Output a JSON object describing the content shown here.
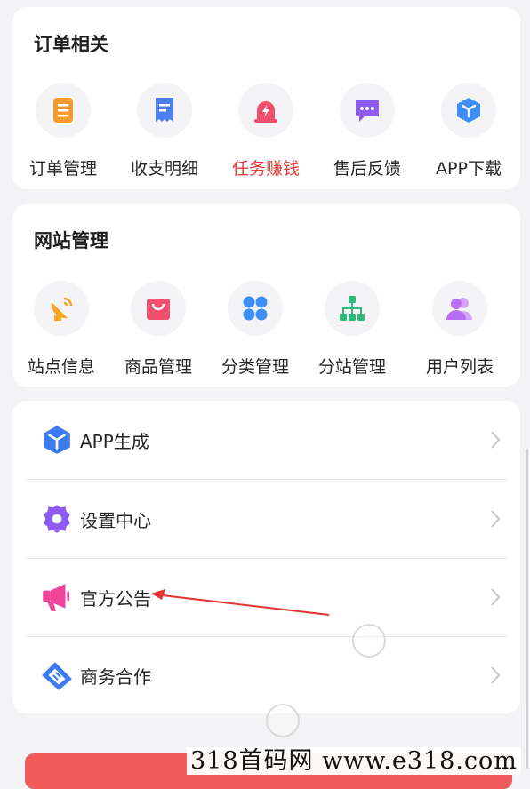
{
  "orders": {
    "title": "订单相关",
    "items": [
      {
        "label": "订单管理",
        "icon": "order-list-icon",
        "color": "#f79a2e"
      },
      {
        "label": "收支明细",
        "icon": "receipt-icon",
        "color": "#4f7ef0"
      },
      {
        "label": "任务赚钱",
        "icon": "alarm-bolt-icon",
        "color": "#f0506e",
        "highlight": true
      },
      {
        "label": "售后反馈",
        "icon": "chat-bubble-icon",
        "color": "#8e5cf0"
      },
      {
        "label": "APP下载",
        "icon": "cube-icon",
        "color": "#3d8ef7"
      }
    ]
  },
  "site": {
    "title": "网站管理",
    "items": [
      {
        "label": "站点信息",
        "icon": "satellite-dish-icon",
        "color": "#f5a623"
      },
      {
        "label": "商品管理",
        "icon": "shopping-bag-icon",
        "color": "#f0506e"
      },
      {
        "label": "分类管理",
        "icon": "category-grid-icon",
        "color": "#3d8ef7"
      },
      {
        "label": "分站管理",
        "icon": "org-tree-icon",
        "color": "#2fb87a"
      },
      {
        "label": "用户列表",
        "icon": "users-icon",
        "color": "#b66df2"
      }
    ]
  },
  "menu": [
    {
      "label": "APP生成",
      "icon": "cube-icon",
      "color": "#3d7bf2"
    },
    {
      "label": "设置中心",
      "icon": "gear-icon",
      "color": "#8e5cf0"
    },
    {
      "label": "官方公告",
      "icon": "megaphone-icon",
      "color": "#f0449a"
    },
    {
      "label": "商务合作",
      "icon": "handshake-icon",
      "color": "#3d7bf2"
    }
  ],
  "watermark": "318首码网  www.e318.com"
}
